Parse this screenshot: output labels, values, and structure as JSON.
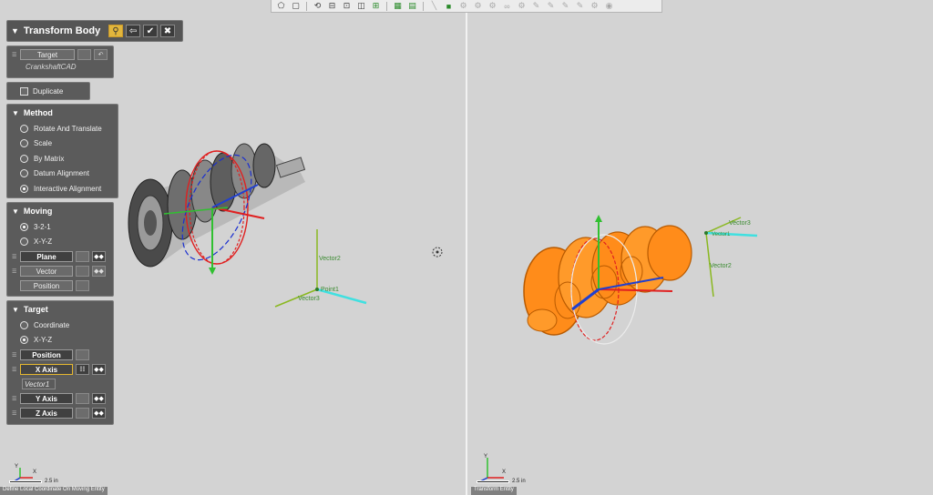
{
  "toolbar": {
    "icons": [
      "select-shape-icon",
      "box-icon",
      "rotate-view-icon",
      "view-top-icon",
      "view-front-icon",
      "view-side-icon",
      "align-icon",
      "grid-icon",
      "table-icon",
      "line-tool-icon",
      "active-green-icon",
      "gear-icon",
      "gear-icon",
      "gear-icon",
      "link-icon",
      "gear-icon",
      "edit-icon",
      "edit-icon",
      "edit-icon",
      "edit-icon",
      "gear-icon",
      "eye-icon"
    ]
  },
  "panel": {
    "title": "Transform Body",
    "title_buttons": [
      "search-icon",
      "back-icon",
      "check-icon",
      "close-icon"
    ],
    "target_top": {
      "label": "Target",
      "value": "CrankshaftCAD"
    },
    "duplicate": {
      "label": "Duplicate",
      "checked": false
    },
    "method": {
      "title": "Method",
      "options": [
        "Rotate And Translate",
        "Scale",
        "By Matrix",
        "Datum Alignment",
        "Interactive Alignment"
      ],
      "selected": "Interactive Alignment"
    },
    "moving": {
      "title": "Moving",
      "options": [
        "3-2-1",
        "X-Y-Z"
      ],
      "selected": "3-2-1",
      "fields": [
        "Plane",
        "Vector",
        "Position"
      ]
    },
    "target": {
      "title": "Target",
      "options": [
        "Coordinate",
        "X-Y-Z"
      ],
      "selected": "X-Y-Z",
      "position_label": "Position",
      "x_axis_label": "X Axis",
      "x_axis_value": "Vector1",
      "y_axis_label": "Y Axis",
      "z_axis_label": "Z Axis"
    }
  },
  "left_view": {
    "labels": {
      "vector2": "Vector2",
      "point": "Point1",
      "vector3": "Vector3"
    },
    "scale_label": "2.5 in",
    "status": "Define Local Coordinate On Moving Entity"
  },
  "right_view": {
    "labels": {
      "vector3": "Vector3",
      "vector2": "Vector2",
      "vector1": "Vector1"
    },
    "scale_label": "2.5 in",
    "status": "Transform Entity"
  },
  "colors": {
    "panel_bg": "#5b5b5b",
    "highlight": "#e6b830",
    "body_orange": "#ff8c1a",
    "axis_red": "#e02020",
    "axis_green": "#30c030",
    "axis_blue": "#2040d0",
    "vector_green": "#8ab820",
    "point_cyan": "#40e0e0"
  }
}
